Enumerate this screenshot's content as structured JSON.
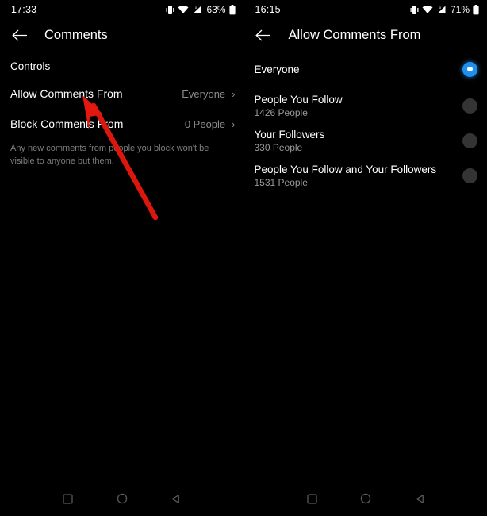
{
  "colors": {
    "background": "#000000",
    "primary_text": "#ffffff",
    "secondary_text": "#8c8c8c",
    "accent_blue": "#1c8fef",
    "radio_unselected": "#343434",
    "annotation_red": "#e01b12"
  },
  "left_panel": {
    "status_bar": {
      "time": "17:33",
      "battery_percent": "63%",
      "icons": [
        "vibrate-icon",
        "wifi-icon",
        "signal-icon",
        "battery-icon"
      ]
    },
    "app_bar": {
      "back_icon": "arrow-left-icon",
      "title": "Comments"
    },
    "section_header": "Controls",
    "rows": [
      {
        "label": "Allow Comments From",
        "value": "Everyone",
        "chevron": "›"
      },
      {
        "label": "Block Comments From",
        "value": "0 People",
        "chevron": "›"
      }
    ],
    "footnote": "Any new comments from people you block won't be visible to anyone but them.",
    "nav_bar": [
      "recents-square-icon",
      "home-circle-icon",
      "back-triangle-icon"
    ]
  },
  "right_panel": {
    "status_bar": {
      "time": "16:15",
      "battery_percent": "71%",
      "icons": [
        "vibrate-icon",
        "wifi-icon",
        "signal-icon",
        "battery-icon"
      ]
    },
    "app_bar": {
      "back_icon": "arrow-left-icon",
      "title": "Allow Comments From"
    },
    "options": [
      {
        "label": "Everyone",
        "sub": "",
        "selected": true
      },
      {
        "label": "People You Follow",
        "sub": "1426 People",
        "selected": false
      },
      {
        "label": "Your Followers",
        "sub": "330 People",
        "selected": false
      },
      {
        "label": "People You Follow and Your Followers",
        "sub": "1531 People",
        "selected": false
      }
    ],
    "nav_bar": [
      "recents-square-icon",
      "home-circle-icon",
      "back-triangle-icon"
    ]
  },
  "annotation": {
    "type": "arrow",
    "color": "#e01b12",
    "points_to": "Allow Comments From"
  }
}
